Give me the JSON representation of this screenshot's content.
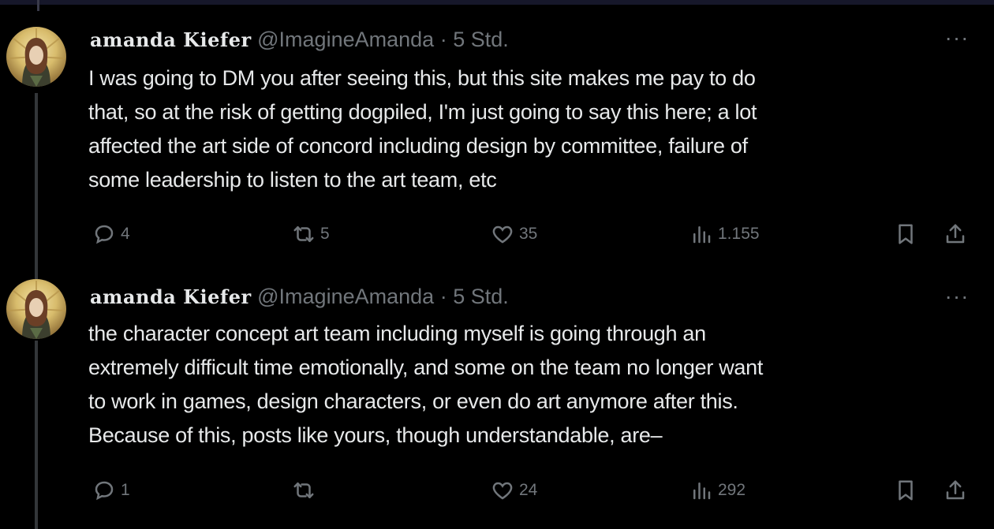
{
  "tweets": [
    {
      "display_name": "amanda Kiefer",
      "handle": "@ImagineAmanda",
      "separator": "·",
      "time": "5 Std.",
      "more": "···",
      "text_lines": [
        "I was going to DM you after seeing this, but this site makes me pay to do",
        "that, so at the risk of getting dogpiled, I'm just going to say this here; a lot",
        "affected the art side of concord including design by committee, failure of",
        "some leadership to listen to the art team, etc"
      ],
      "replies": "4",
      "reposts": "5",
      "likes": "35",
      "views": "1.155"
    },
    {
      "display_name": "amanda Kiefer",
      "handle": "@ImagineAmanda",
      "separator": "·",
      "time": "5 Std.",
      "more": "···",
      "text_lines": [
        "the character concept art team including myself is going through an",
        "extremely difficult time emotionally, and some on the team no longer want",
        "to work in games, design characters, or even do art anymore after this.",
        "Because of this, posts like yours, though understandable, are–"
      ],
      "replies": "1",
      "reposts": "",
      "likes": "24",
      "views": "292"
    }
  ],
  "icons": {
    "reply": "speech-bubble-icon",
    "repost": "repost-arrows-icon",
    "like": "heart-icon",
    "views": "bar-chart-icon",
    "bookmark": "bookmark-icon",
    "share": "share-upload-icon"
  },
  "colors": {
    "background": "#000000",
    "text": "#e7e9ea",
    "muted": "#71767b",
    "thread_line": "#333639",
    "top_bar": "#16172a"
  }
}
